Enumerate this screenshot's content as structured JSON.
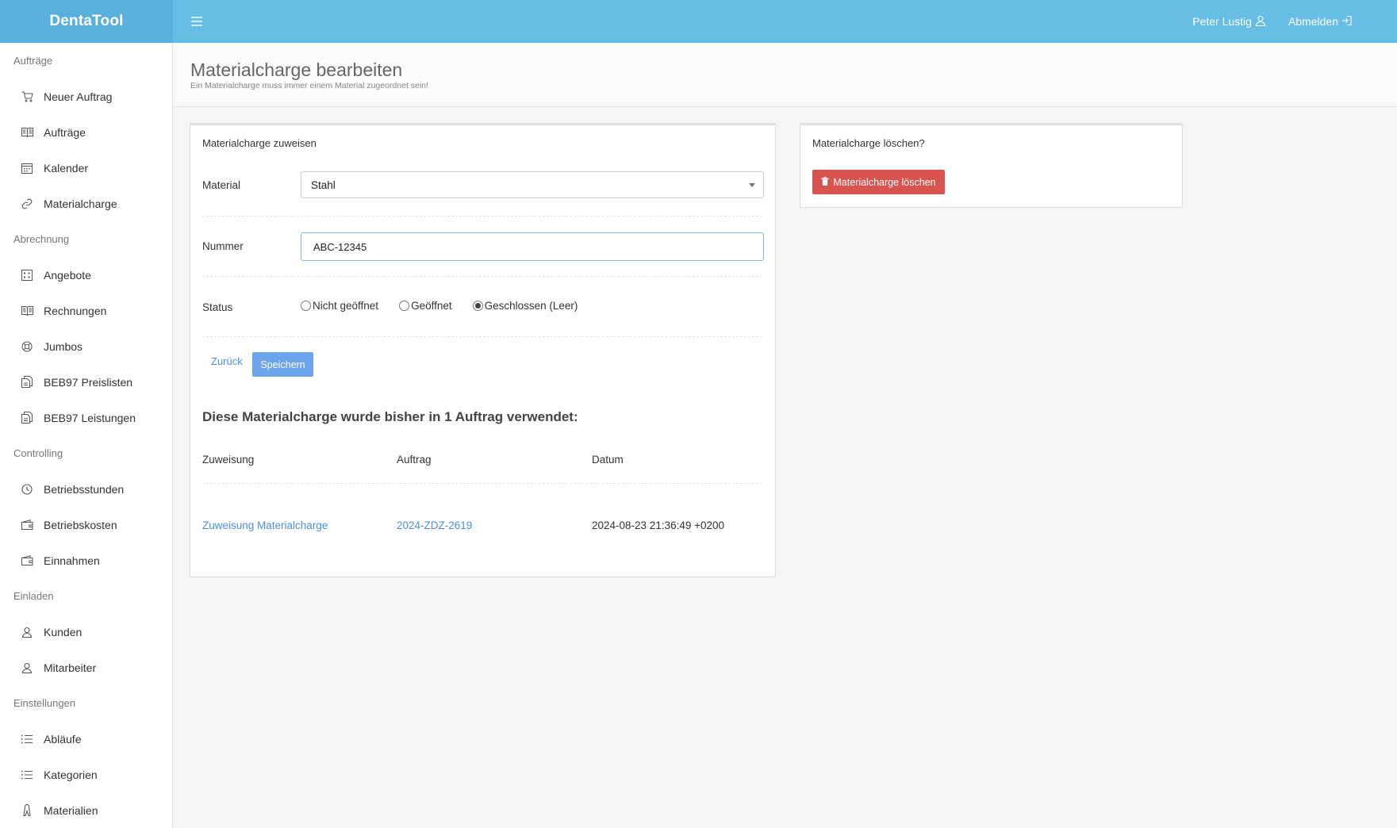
{
  "app": {
    "brand": "DentaTool"
  },
  "topbar": {
    "user_name": "Peter Lustig",
    "logout_label": "Abmelden"
  },
  "sidebar": {
    "sections": [
      {
        "label": "Aufträge",
        "items": [
          {
            "label": "Neuer Auftrag",
            "icon": "cart-icon"
          },
          {
            "label": "Aufträge",
            "icon": "book-icon"
          },
          {
            "label": "Kalender",
            "icon": "calendar-icon"
          },
          {
            "label": "Materialcharge",
            "icon": "link-icon"
          }
        ]
      },
      {
        "label": "Abrechnung",
        "items": [
          {
            "label": "Angebote",
            "icon": "grid-icon"
          },
          {
            "label": "Rechnungen",
            "icon": "book-icon"
          },
          {
            "label": "Jumbos",
            "icon": "lifebuoy-icon"
          },
          {
            "label": "BEB97 Preislisten",
            "icon": "copy-icon"
          },
          {
            "label": "BEB97 Leistungen",
            "icon": "copy-icon"
          }
        ]
      },
      {
        "label": "Controlling",
        "items": [
          {
            "label": "Betriebsstunden",
            "icon": "clock-icon"
          },
          {
            "label": "Betriebskosten",
            "icon": "wallet-icon"
          },
          {
            "label": "Einnahmen",
            "icon": "wallet-icon"
          }
        ]
      },
      {
        "label": "Einladen",
        "items": [
          {
            "label": "Kunden",
            "icon": "user-icon"
          },
          {
            "label": "Mitarbeiter",
            "icon": "user-icon"
          }
        ]
      },
      {
        "label": "Einstellungen",
        "items": [
          {
            "label": "Abläufe",
            "icon": "list-icon"
          },
          {
            "label": "Kategorien",
            "icon": "list-icon"
          },
          {
            "label": "Materialien",
            "icon": "tooth-icon"
          }
        ]
      }
    ]
  },
  "page": {
    "title": "Materialcharge bearbeiten",
    "subtitle": "Ein Materialcharge muss immer einem Material zugeordnet sein!"
  },
  "form": {
    "panel_title": "Materialcharge zuweisen",
    "material_label": "Material",
    "material_value": "Stahl",
    "number_label": "Nummer",
    "number_value": "ABC-12345",
    "status_label": "Status",
    "status_options": [
      {
        "label": "Nicht geöffnet",
        "checked": false
      },
      {
        "label": "Geöffnet",
        "checked": false
      },
      {
        "label": "Geschlossen (Leer)",
        "checked": true
      }
    ],
    "back_label": "Zurück",
    "save_label": "Speichern"
  },
  "usage": {
    "heading": "Diese Materialcharge wurde bisher in 1 Auftrag verwendet:",
    "columns": [
      "Zuweisung",
      "Auftrag",
      "Datum"
    ],
    "rows": [
      {
        "assignment": "Zuweisung Materialcharge",
        "order": "2024-ZDZ-2619",
        "date": "2024-08-23 21:36:49 +0200"
      }
    ]
  },
  "delete_panel": {
    "title": "Materialcharge löschen?",
    "button_label": "Materialcharge löschen"
  },
  "colors": {
    "topbar": "#66bde6",
    "brand": "#5ab0dc",
    "primary": "#6ba4ea",
    "danger": "#d9534f",
    "link": "#4a90e2"
  }
}
